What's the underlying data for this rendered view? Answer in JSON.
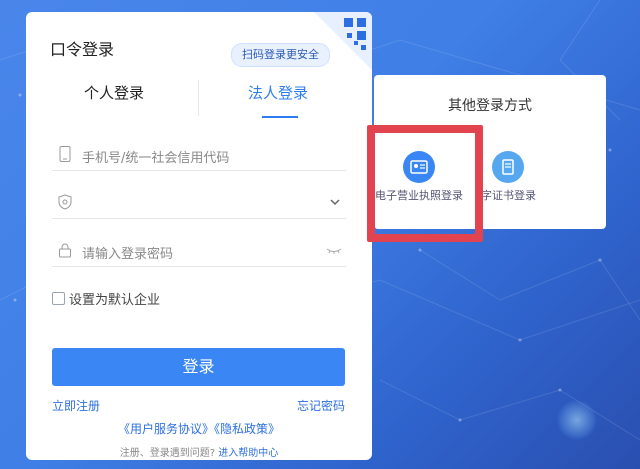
{
  "login": {
    "title": "口令登录",
    "qr_tip": "扫码登录更安全",
    "tabs": [
      {
        "label": "个人登录",
        "active": false
      },
      {
        "label": "法人登录",
        "active": true
      }
    ],
    "fields": {
      "account_placeholder": "手机号/统一社会信用代码",
      "company_select_value": "",
      "password_placeholder": "请输入登录密码"
    },
    "default_company_label": "设置为默认企业",
    "submit_label": "登录",
    "register_label": "立即注册",
    "forgot_label": "忘记密码",
    "policy_text": "《用户服务协议》《隐私政策》",
    "help_prefix": "注册、登录遇到问题?",
    "help_link": "进入帮助中心"
  },
  "other_login": {
    "title": "其他登录方式",
    "options": [
      {
        "label": "电子营业执照登录",
        "icon": "license-card-icon",
        "highlighted": true
      },
      {
        "label": "字证书登录",
        "icon": "certificate-icon",
        "highlighted": false
      }
    ]
  },
  "colors": {
    "primary": "#3a86f5",
    "link": "#2d6fe0",
    "highlight_border": "#e1444f",
    "background": "#3f7fe6"
  }
}
